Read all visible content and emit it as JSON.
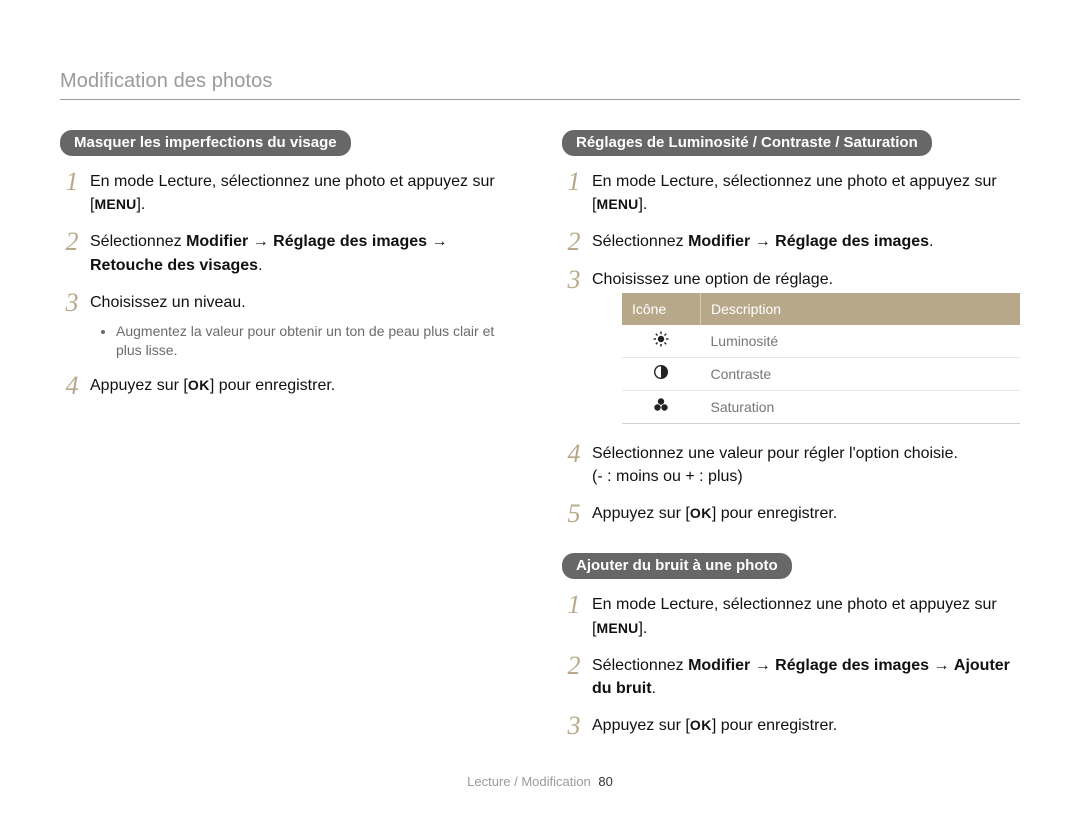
{
  "page_title": "Modification des photos",
  "left": {
    "section1": {
      "heading": "Masquer les imperfections du visage",
      "steps": {
        "s1a": "En mode Lecture, sélectionnez une photo et appuyez sur [",
        "s1b": "].",
        "menu": "MENU",
        "s2a": "Sélectionnez ",
        "s2b": "Modifier",
        "s2arrow1": " → ",
        "s2c": "Réglage des images",
        "s2arrow2": " → ",
        "s2d": "Retouche des visages",
        "s2e": ".",
        "s3": "Choisissez un niveau.",
        "s3_sub1": "Augmentez la valeur pour obtenir un ton de peau plus clair et plus lisse.",
        "s4a": "Appuyez sur [",
        "ok": "OK",
        "s4b": "] pour enregistrer."
      }
    }
  },
  "right": {
    "section1": {
      "heading": "Réglages de Luminosité / Contraste / Saturation",
      "steps": {
        "s1a": "En mode Lecture, sélectionnez une photo et appuyez sur [",
        "s1b": "].",
        "menu": "MENU",
        "s2a": "Sélectionnez ",
        "s2b": "Modifier",
        "s2arrow": " → ",
        "s2c": "Réglage des images",
        "s2d": ".",
        "s3": "Choisissez une option de réglage.",
        "s4": "Sélectionnez une valeur pour régler l'option choisie.",
        "s4b": "(- : moins ou + : plus)",
        "s5a": "Appuyez sur [",
        "ok": "OK",
        "s5b": "] pour enregistrer."
      },
      "table": {
        "h1": "Icône",
        "h2": "Description",
        "r1": "Luminosité",
        "r2": "Contraste",
        "r3": "Saturation"
      }
    },
    "section2": {
      "heading": "Ajouter du bruit à une photo",
      "steps": {
        "s1a": "En mode Lecture, sélectionnez une photo et appuyez sur [",
        "s1b": "].",
        "menu": "MENU",
        "s2a": "Sélectionnez ",
        "s2b": "Modifier",
        "s2arrow1": " → ",
        "s2c": "Réglage des images",
        "s2arrow2": " → ",
        "s2d": "Ajouter du bruit",
        "s2e": ".",
        "s3a": "Appuyez sur [",
        "ok": "OK",
        "s3b": "] pour enregistrer."
      }
    }
  },
  "footer": {
    "section": "Lecture / Modification",
    "page_number": "80"
  },
  "icons": {
    "brightness": "brightness-icon",
    "contrast": "contrast-icon",
    "saturation": "saturation-icon"
  }
}
